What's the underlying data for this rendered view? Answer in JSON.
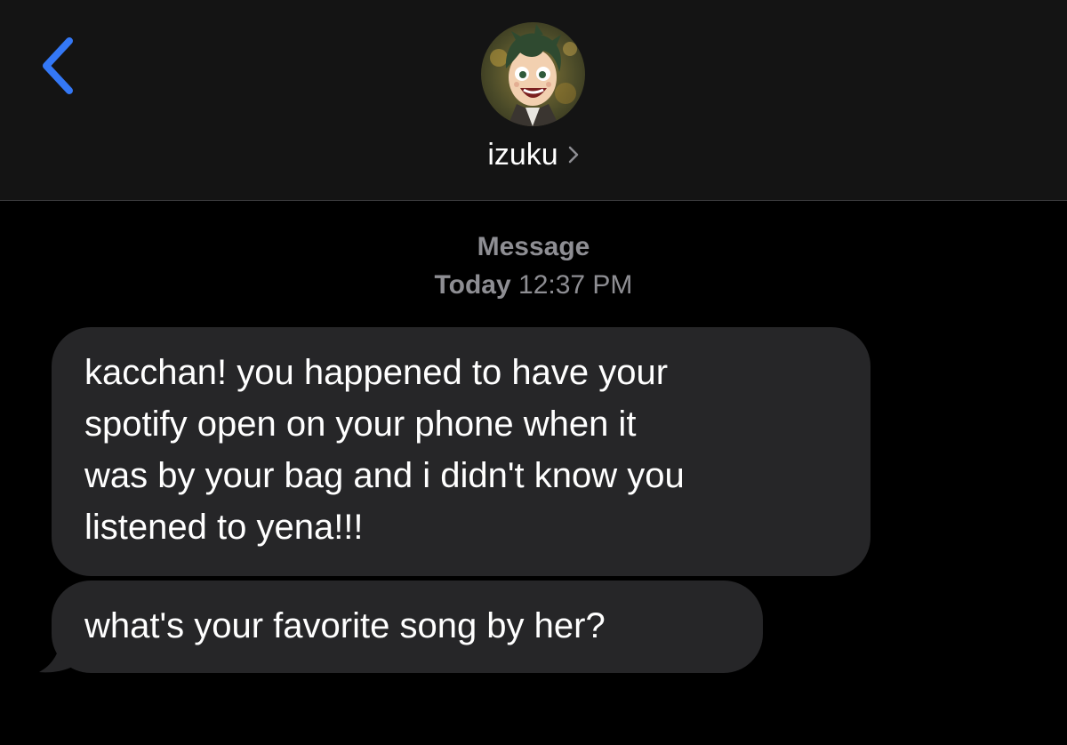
{
  "header": {
    "back_icon": "chevron-left-icon",
    "contact_name": "izuku",
    "name_chevron_icon": "chevron-right-icon",
    "avatar": "contact-avatar"
  },
  "thread": {
    "service_label": "Message",
    "timestamp_day": "Today",
    "timestamp_time": "12:37 PM"
  },
  "messages": [
    {
      "direction": "incoming",
      "lines": [
        "kacchan! you happened to have your",
        "spotify open on your phone when it",
        "was by your bag and i didn't know you",
        "listened to yena!!!"
      ]
    },
    {
      "direction": "incoming",
      "lines": [
        "what's your favorite song by her?"
      ]
    }
  ],
  "colors": {
    "background": "#000000",
    "header_bg": "#141414",
    "bubble_incoming": "#262628",
    "accent": "#3478f6",
    "meta_text": "#8e8e93"
  }
}
